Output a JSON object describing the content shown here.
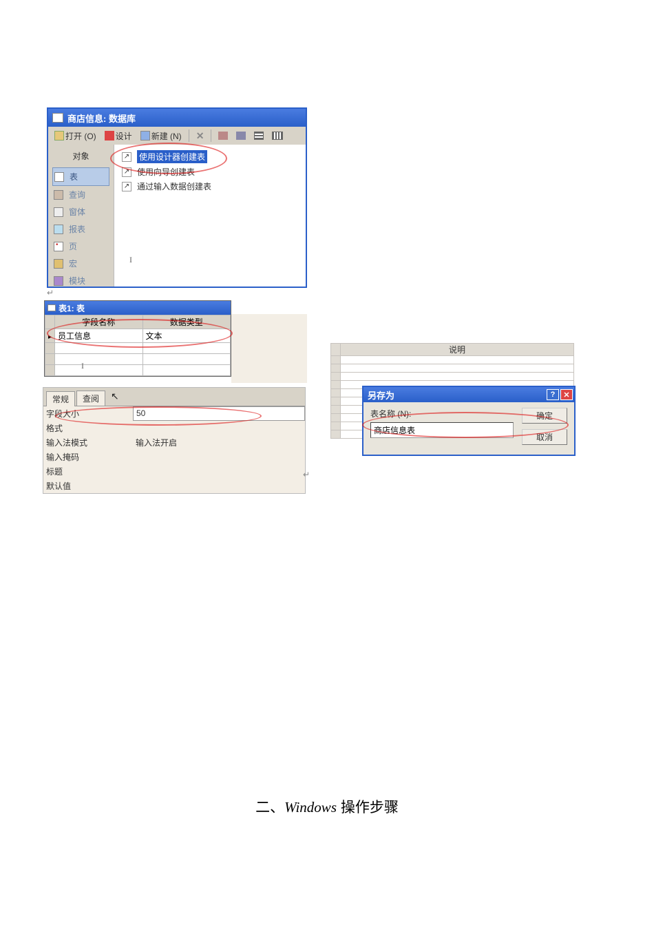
{
  "db_window": {
    "title": "商店信息: 数据库",
    "toolbar": {
      "open": "打开 (O)",
      "design": "设计",
      "new": "新建 (N)"
    },
    "sidebar_header": "对象",
    "sidebar_items": [
      {
        "label": "表"
      },
      {
        "label": "查询"
      },
      {
        "label": "窗体"
      },
      {
        "label": "报表"
      },
      {
        "label": "页"
      },
      {
        "label": "宏"
      },
      {
        "label": "模块"
      }
    ],
    "create_items": [
      {
        "label": "使用设计器创建表"
      },
      {
        "label": "使用向导创建表"
      },
      {
        "label": "通过输入数据创建表"
      }
    ]
  },
  "table_design": {
    "title": "表1: 表",
    "columns": [
      "字段名称",
      "数据类型"
    ],
    "rows": [
      {
        "name": "员工信息",
        "type": "文本"
      },
      {
        "name": "",
        "type": ""
      },
      {
        "name": "",
        "type": ""
      },
      {
        "name": "",
        "type": ""
      }
    ],
    "desc_column": "说明"
  },
  "props": {
    "tabs": [
      "常规",
      "查阅"
    ],
    "field_size_label": "字段大小",
    "field_size_value": "50",
    "format_label": "格式",
    "format_value": "",
    "ime_mode_label": "输入法模式",
    "ime_mode_value": "输入法开启",
    "input_mask_label": "输入掩码",
    "input_mask_value": "",
    "caption_label": "标题",
    "caption_value": "",
    "default_label": "默认值",
    "default_value": ""
  },
  "saveas": {
    "title": "另存为",
    "label": "表名称 (N):",
    "value": "商店信息表",
    "ok": "确定",
    "cancel": "取消"
  },
  "footer": {
    "text_prefix": "二、",
    "text_italic": "Windows",
    "text_suffix": " 操作步骤"
  }
}
